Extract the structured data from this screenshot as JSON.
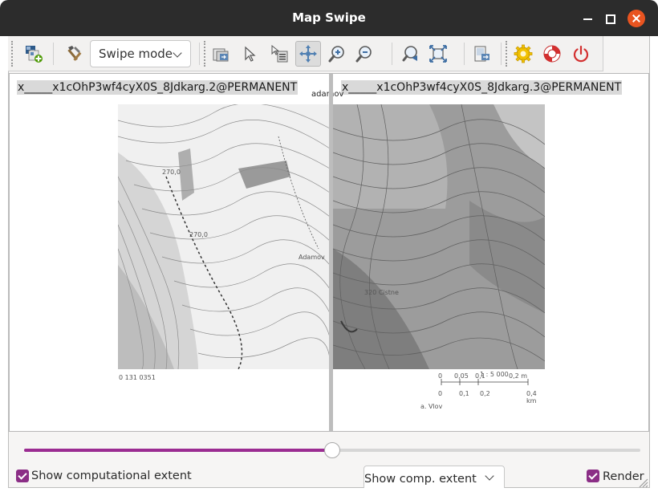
{
  "window": {
    "title": "Map Swipe"
  },
  "toolbar": {
    "swipe_mode_label": "Swipe mode",
    "tools": [
      {
        "name": "add-layers-icon",
        "tooltip": "Add layers"
      },
      {
        "name": "settings-hammer-icon",
        "tooltip": "Settings"
      },
      {
        "name": "zoom-to-layers-icon",
        "tooltip": "Zoom to layers"
      },
      {
        "name": "pointer-icon",
        "tooltip": "Pointer"
      },
      {
        "name": "query-icon",
        "tooltip": "Query"
      },
      {
        "name": "pan-icon",
        "tooltip": "Pan",
        "active": true
      },
      {
        "name": "zoom-in-icon",
        "tooltip": "Zoom in"
      },
      {
        "name": "zoom-out-icon",
        "tooltip": "Zoom out"
      },
      {
        "name": "zoom-back-icon",
        "tooltip": "Zoom back"
      },
      {
        "name": "zoom-extent-icon",
        "tooltip": "Zoom to extent"
      },
      {
        "name": "export-map-icon",
        "tooltip": "Export map"
      },
      {
        "name": "preferences-gear-icon",
        "tooltip": "Preferences"
      },
      {
        "name": "help-lifebuoy-icon",
        "tooltip": "Help"
      },
      {
        "name": "quit-power-icon",
        "tooltip": "Quit"
      }
    ]
  },
  "canvas": {
    "left_layer": "x_____x1cOhP3wf4cyX0S_8Jdkarg.2@PERMANENT",
    "right_layer": "x_____x1cOhP3wf4cyX0S_8Jdkarg.3@PERMANENT",
    "map_labels": {
      "top_center": "adamov",
      "left_spot": "270,0",
      "left_spot2": "270,0",
      "mid_label": "Adamov",
      "right_spot": "320 Cistne",
      "bottom_left": "0 131 0351",
      "scale_title": "1 : 5 000",
      "scale_ticks": [
        "0",
        "0,05",
        "0,1",
        "0,2 m"
      ],
      "scale_ticks_km": [
        "0",
        "0,1",
        "0,2",
        "0,4 km"
      ],
      "bottom_right": "a. Vlov"
    }
  },
  "swipe": {
    "position_fraction": 0.5
  },
  "options": {
    "show_extent_label": "Show computational extent",
    "show_extent_checked": true,
    "extent_combo_value": "Show comp. extent",
    "render_label": "Render",
    "render_checked": true
  },
  "colors": {
    "accent": "#9b2c92",
    "checkbox": "#8b2e86",
    "titlebar": "#2c2c2c",
    "close": "#e95420"
  }
}
